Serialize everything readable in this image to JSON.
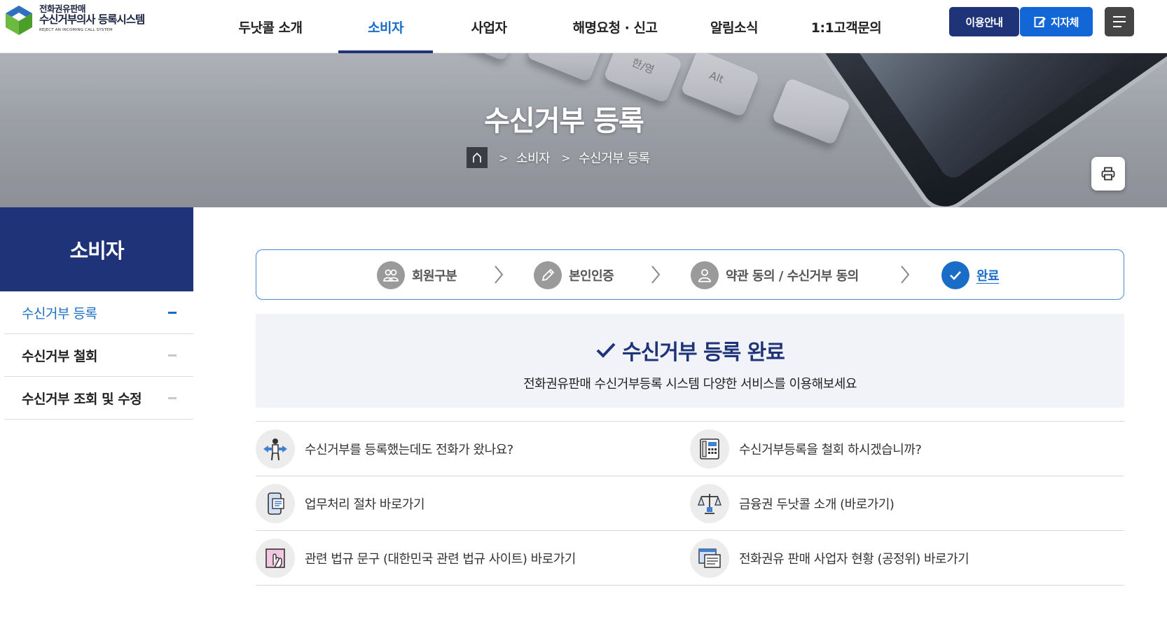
{
  "header": {
    "logo": {
      "line1": "전화권유판매",
      "line2": "수신거부의사 등록시스템",
      "line3": "REJECT AN INCOMING CALL SYSTEM"
    },
    "nav": [
      {
        "label": "두낫콜 소개",
        "active": false
      },
      {
        "label": "소비자",
        "active": true
      },
      {
        "label": "사업자",
        "active": false
      },
      {
        "label": "해명요청 · 신고",
        "active": false
      },
      {
        "label": "알림소식",
        "active": false
      },
      {
        "label": "1:1고객문의",
        "active": false
      }
    ],
    "guide_label": "이용안내",
    "local_gov_label": "지자체"
  },
  "banner": {
    "title": "수신거부 등록",
    "breadcrumb": [
      "소비자",
      "수신거부 등록"
    ],
    "key_labels": [
      "한/영",
      "Alt"
    ]
  },
  "sidebar": {
    "title": "소비자",
    "items": [
      {
        "label": "수신거부 등록",
        "active": true
      },
      {
        "label": "수신거부 철회",
        "active": false
      },
      {
        "label": "수신거부 조회 및 수정",
        "active": false
      }
    ]
  },
  "steps": [
    {
      "label": "회원구분",
      "icon": "users-icon",
      "done": false
    },
    {
      "label": "본인인증",
      "icon": "pencil-icon",
      "done": false
    },
    {
      "label": "약관 동의 / 수신거부 동의",
      "icon": "user-icon",
      "done": false
    },
    {
      "label": "완료",
      "icon": "check-icon",
      "done": true
    }
  ],
  "complete": {
    "title": "수신거부 등록 완료",
    "subtitle": "전화권유판매 수신거부등록 시스템 다양한 서비스를 이용해보세요"
  },
  "links": [
    {
      "label": "수신거부를 등록했는데도 전화가 왔나요?",
      "icon": "direction-person-icon"
    },
    {
      "label": "수신거부등록을 철회 하시겠습니까?",
      "icon": "phone-device-icon"
    },
    {
      "label": "업무처리 절차 바로가기",
      "icon": "mobile-document-icon"
    },
    {
      "label": "금융권 두낫콜 소개 (바로가기)",
      "icon": "scale-icon"
    },
    {
      "label": "관련 법규 문구 (대한민국 관련 법규 사이트) 바로가기",
      "icon": "touch-screen-icon"
    },
    {
      "label": "전화권유 판매 사업자 현황 (공정위) 바로가기",
      "icon": "document-stack-icon"
    }
  ],
  "colors": {
    "navy": "#1f3478",
    "blue": "#1a6dc7",
    "bright_blue": "#1366d6",
    "dark_gray": "#454545",
    "light_bg": "#f1f3f8"
  }
}
